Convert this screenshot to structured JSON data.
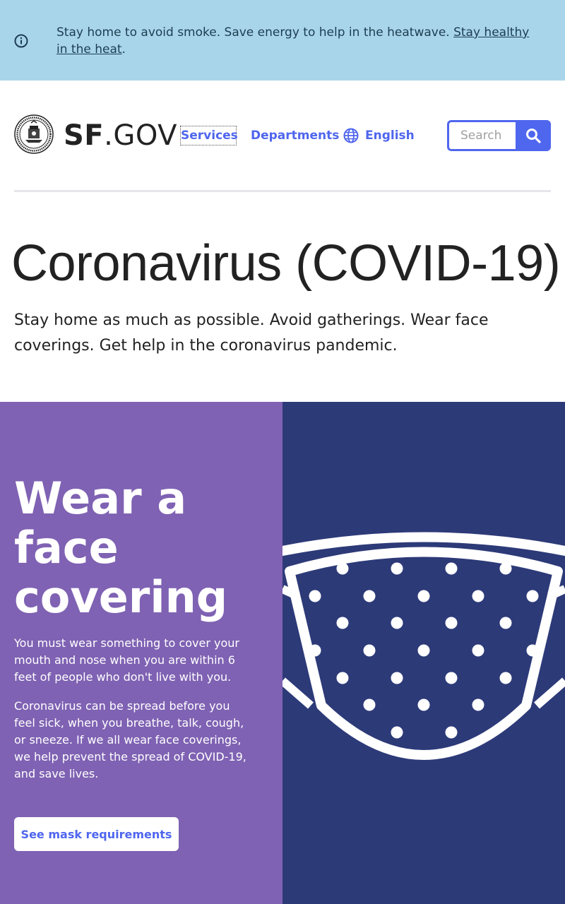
{
  "alert": {
    "text": "Stay home to avoid smoke. Save energy to help in the heatwave. ",
    "link": "Stay healthy in the heat",
    "suffix": "."
  },
  "header": {
    "logo_sf": "SF",
    "logo_gov": ".GOV",
    "nav": {
      "services": "Services",
      "departments": "Departments",
      "language": "English"
    },
    "search_placeholder": "Search"
  },
  "page": {
    "title": "Coronavirus (COVID-19)",
    "description": "Stay home as much as possible. Avoid gatherings. Wear face coverings. Get help in the coronavirus pandemic."
  },
  "promo": {
    "title": "Wear a face covering",
    "paragraph1": "You must wear something to cover your mouth and nose when you are within 6 feet of people who don't live with you.",
    "paragraph2": "Coronavirus can be spread before you feel sick, when you breathe, talk, cough, or sneeze. If we all wear face coverings, we help prevent the spread of COVID-19, and save lives.",
    "button": "See mask requirements"
  },
  "colors": {
    "alert_bg": "#a9d5ea",
    "accent": "#4f66ee",
    "promo_purple": "#7f62b3",
    "promo_navy": "#2d3a78"
  },
  "icons": {
    "alert": "info-icon",
    "seal": "city-seal-icon",
    "language": "globe-icon",
    "search": "search-icon",
    "mask": "face-mask-illustration"
  }
}
